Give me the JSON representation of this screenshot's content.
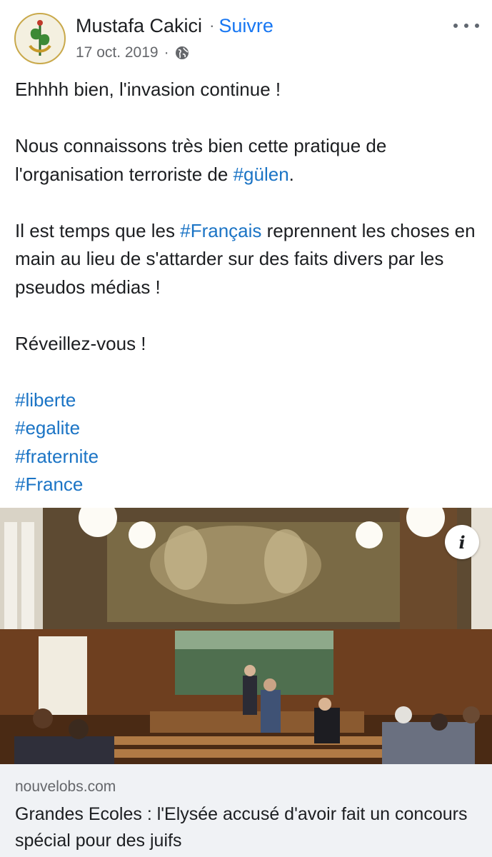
{
  "post": {
    "author": "Mustafa Cakici",
    "separator": "·",
    "follow_label": "Suivre",
    "date": "17 oct. 2019",
    "meta_separator": "·",
    "privacy_icon": "globe-icon",
    "more_icon": "more-options-icon"
  },
  "body": {
    "line1": "Ehhhh bien, l'invasion continue !",
    "p2_text": "Nous connaissons très bien cette pratique de l'organisation terroriste de ",
    "p2_tag": "#gülen",
    "p2_end": ".",
    "p3_start": "Il est temps que les ",
    "p3_tag": "#Français",
    "p3_end": " reprennent les choses en main au lieu de s'attarder sur des faits divers par les pseudos médias !",
    "line4": "Réveillez-vous !",
    "hashtags": [
      "#liberte",
      "#egalite",
      "#fraternite",
      "#France"
    ]
  },
  "link_preview": {
    "info_icon": "info-icon",
    "info_label": "i",
    "domain": "nouvelobs.com",
    "title": "Grandes Ecoles : l'Elysée accusé d'avoir fait un concours spécial pour des juifs"
  },
  "colors": {
    "link": "#1b74c5",
    "follow": "#1877f2",
    "meta": "#65676b",
    "card_bg": "#f0f2f5"
  }
}
